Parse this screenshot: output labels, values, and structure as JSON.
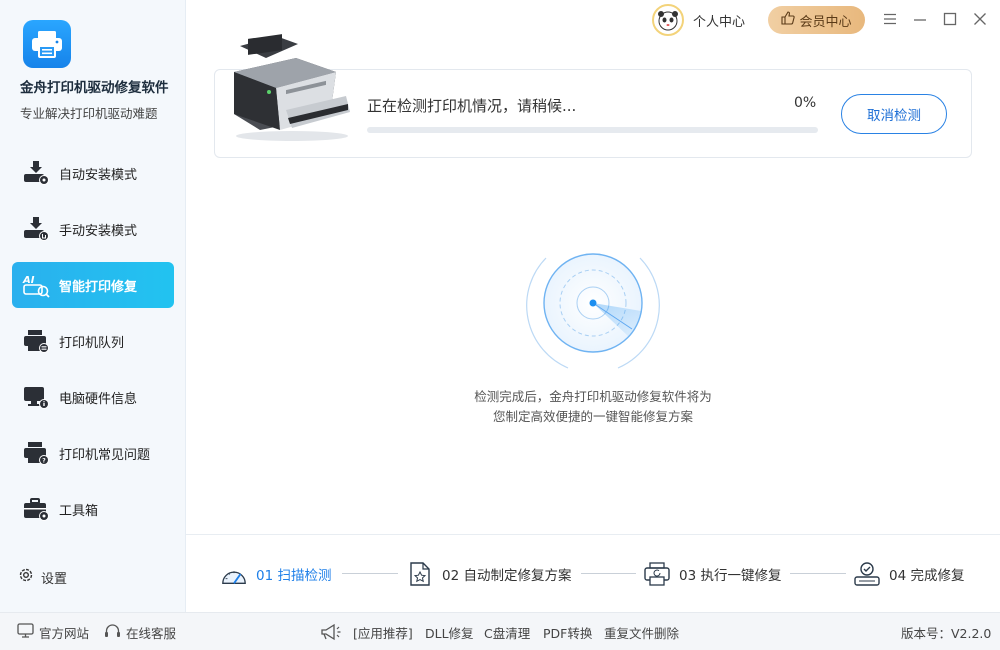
{
  "app": {
    "name": "金舟打印机驱动修复软件",
    "slogan": "专业解决打印机驱动难题"
  },
  "sidebar": {
    "items": [
      {
        "label": "自动安装模式",
        "icon": "printer-auto-gear-icon",
        "active": false
      },
      {
        "label": "手动安装模式",
        "icon": "printer-manual-hand-icon",
        "active": false
      },
      {
        "label": "智能打印修复",
        "icon": "ai-repair-icon",
        "active": true
      },
      {
        "label": "打印机队列",
        "icon": "printer-queue-icon",
        "active": false
      },
      {
        "label": "电脑硬件信息",
        "icon": "computer-info-icon",
        "active": false
      },
      {
        "label": "打印机常见问题",
        "icon": "printer-faq-icon",
        "active": false
      },
      {
        "label": "工具箱",
        "icon": "toolbox-icon",
        "active": false
      }
    ],
    "settings_label": "设置"
  },
  "header": {
    "personal_center": "个人中心",
    "vip_center": "会员中心"
  },
  "scan": {
    "status_text": "正在检测打印机情况，请稍候...",
    "percent_text": "0%",
    "progress": 0,
    "cancel_label": "取消检测"
  },
  "radar": {
    "line1": "检测完成后，金舟打印机驱动修复软件将为",
    "line2": "您制定高效便捷的一键智能修复方案"
  },
  "steps": [
    {
      "label": "01 扫描检测",
      "icon": "gauge-scan-icon",
      "active": true
    },
    {
      "label": "02 自动制定修复方案",
      "icon": "document-star-icon",
      "active": false
    },
    {
      "label": "03 执行一键修复",
      "icon": "printer-refresh-icon",
      "active": false
    },
    {
      "label": "04 完成修复",
      "icon": "check-complete-icon",
      "active": false
    }
  ],
  "footer": {
    "official_site": "官方网站",
    "online_service": "在线客服",
    "recommend": "[应用推荐]",
    "links": [
      "DLL修复",
      "C盘清理",
      "PDF转换",
      "重复文件删除"
    ],
    "version": "版本号：V2.2.0"
  },
  "colors": {
    "accent": "#1e7fe8",
    "active_nav": "#22b8f0",
    "vip_gold": "#e8b87d"
  }
}
